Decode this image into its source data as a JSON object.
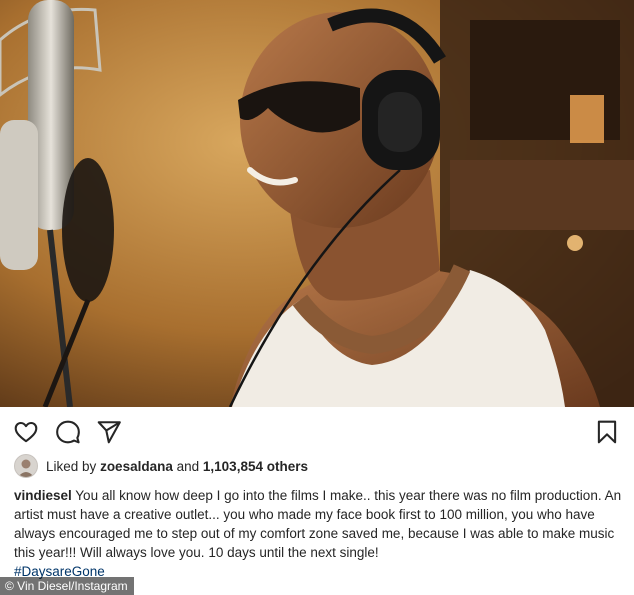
{
  "post": {
    "photo_alt": "",
    "actions": {
      "like_icon": "heart-outline-icon",
      "comment_icon": "comment-bubble-icon",
      "share_icon": "paper-plane-icon",
      "save_icon": "bookmark-icon"
    },
    "likes": {
      "prefix": "Liked by",
      "user": "zoesaldana",
      "connector": "and",
      "count": "1,103,854 others"
    },
    "caption": {
      "username": "vindiesel",
      "text": "You all know how deep I go into the films I make.. this year there was no film production. An artist must have a creative outlet... you who made my face book first to 100 million, you who have always encouraged me to step out of my comfort zone saved me, because I was able to make music this year!!! Will always love you. 10 days until the next single!",
      "hashtag": "#DaysareGone"
    }
  },
  "credit": "© Vin Diesel/Instagram",
  "colors": {
    "text": "#262626",
    "hashtag": "#003569",
    "photo_warm": "#b07a38"
  }
}
